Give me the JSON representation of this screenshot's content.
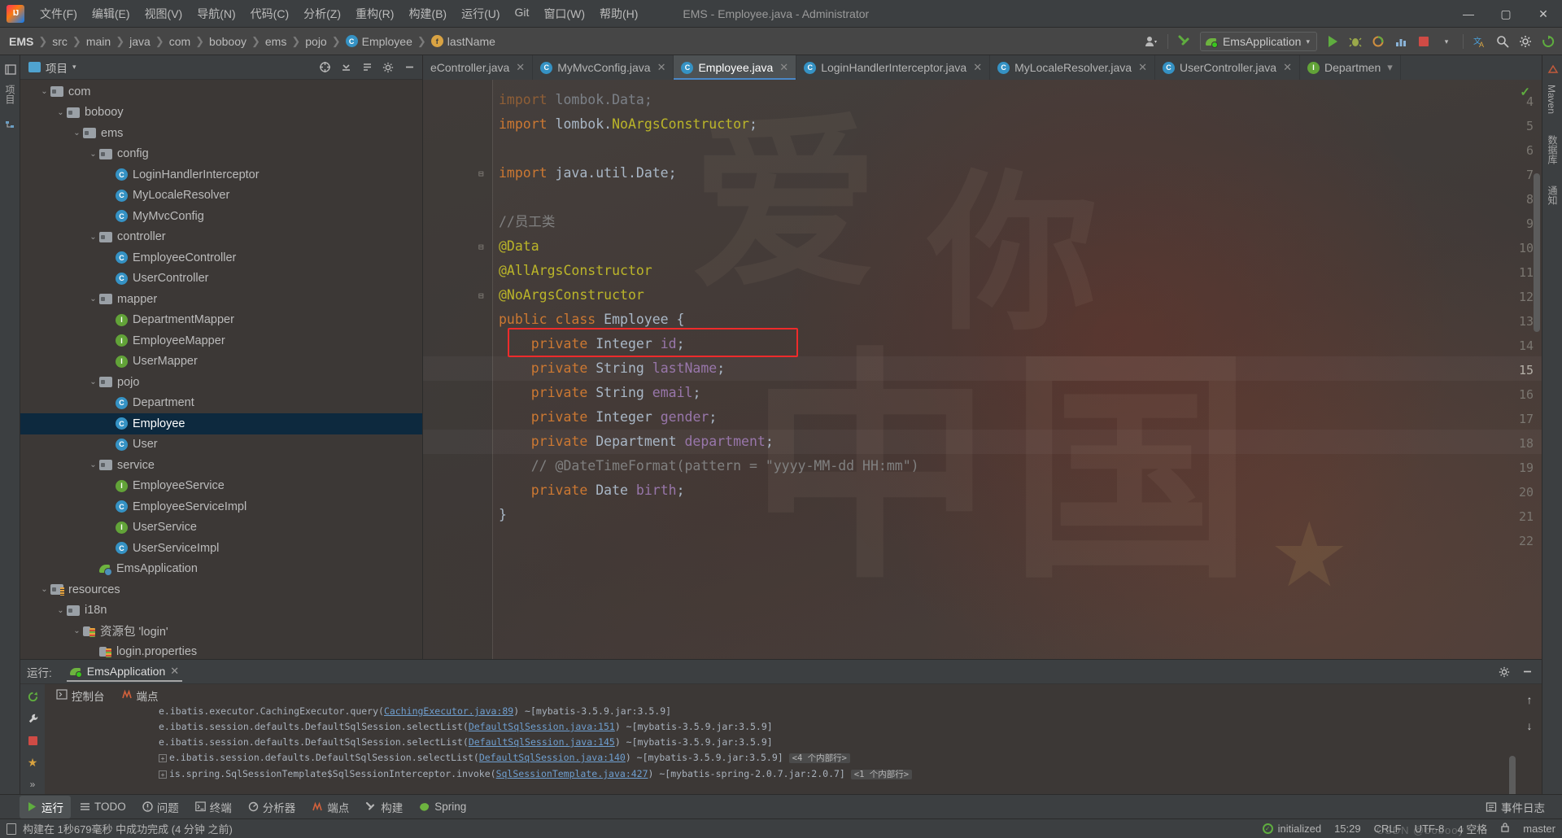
{
  "window": {
    "title": "EMS - Employee.java - Administrator",
    "minimize": "—",
    "maximize": "▢",
    "close": "✕"
  },
  "menu": {
    "items": [
      "文件(F)",
      "编辑(E)",
      "视图(V)",
      "导航(N)",
      "代码(C)",
      "分析(Z)",
      "重构(R)",
      "构建(B)",
      "运行(U)",
      "Git",
      "窗口(W)",
      "帮助(H)"
    ]
  },
  "navbar": {
    "breadcrumbs": [
      {
        "label": "EMS",
        "badge": ""
      },
      {
        "label": "src",
        "badge": ""
      },
      {
        "label": "main",
        "badge": ""
      },
      {
        "label": "java",
        "badge": ""
      },
      {
        "label": "com",
        "badge": ""
      },
      {
        "label": "bobooy",
        "badge": ""
      },
      {
        "label": "ems",
        "badge": ""
      },
      {
        "label": "pojo",
        "badge": ""
      },
      {
        "label": "Employee",
        "badge": "C"
      },
      {
        "label": "lastName",
        "badge": "f"
      }
    ],
    "separator": "❯",
    "run_config": "EmsApplication",
    "run_config_caret": "▾",
    "icons": {
      "user": "user-icon",
      "build": "build-hammer-icon",
      "run": "run-icon",
      "debug": "debug-icon",
      "coverage": "coverage-icon",
      "profile": "profile-icon",
      "stop": "stop-icon",
      "translate": "translate-icon",
      "search": "search-icon",
      "settings": "gear-icon",
      "updates": "updates-icon"
    }
  },
  "left_strip": {
    "project": "项目",
    "structure": "结构"
  },
  "right_strip": {
    "maven": "Maven",
    "database": "数据库",
    "notifications": "通知"
  },
  "project_panel": {
    "title": "项目",
    "caret": "▾",
    "header_icons": [
      "target-icon",
      "collapse-all-icon",
      "expand-icon",
      "gear-icon",
      "hide-icon"
    ],
    "tree": [
      {
        "depth": 2,
        "arrow": "⌄",
        "icon": "folder",
        "label": "com",
        "selected": false
      },
      {
        "depth": 3,
        "arrow": "⌄",
        "icon": "folder",
        "label": "bobooy",
        "selected": false
      },
      {
        "depth": 4,
        "arrow": "⌄",
        "icon": "folder",
        "label": "ems",
        "selected": false
      },
      {
        "depth": 5,
        "arrow": "⌄",
        "icon": "folder",
        "label": "config",
        "selected": false
      },
      {
        "depth": 6,
        "arrow": "",
        "icon": "class",
        "label": "LoginHandlerInterceptor",
        "selected": false
      },
      {
        "depth": 6,
        "arrow": "",
        "icon": "class",
        "label": "MyLocaleResolver",
        "selected": false
      },
      {
        "depth": 6,
        "arrow": "",
        "icon": "class",
        "label": "MyMvcConfig",
        "selected": false
      },
      {
        "depth": 5,
        "arrow": "⌄",
        "icon": "folder",
        "label": "controller",
        "selected": false
      },
      {
        "depth": 6,
        "arrow": "",
        "icon": "class",
        "label": "EmployeeController",
        "selected": false
      },
      {
        "depth": 6,
        "arrow": "",
        "icon": "class",
        "label": "UserController",
        "selected": false
      },
      {
        "depth": 5,
        "arrow": "⌄",
        "icon": "folder",
        "label": "mapper",
        "selected": false
      },
      {
        "depth": 6,
        "arrow": "",
        "icon": "interface",
        "label": "DepartmentMapper",
        "selected": false
      },
      {
        "depth": 6,
        "arrow": "",
        "icon": "interface",
        "label": "EmployeeMapper",
        "selected": false
      },
      {
        "depth": 6,
        "arrow": "",
        "icon": "interface",
        "label": "UserMapper",
        "selected": false
      },
      {
        "depth": 5,
        "arrow": "⌄",
        "icon": "folder",
        "label": "pojo",
        "selected": false
      },
      {
        "depth": 6,
        "arrow": "",
        "icon": "class",
        "label": "Department",
        "selected": false
      },
      {
        "depth": 6,
        "arrow": "",
        "icon": "class",
        "label": "Employee",
        "selected": true
      },
      {
        "depth": 6,
        "arrow": "",
        "icon": "class",
        "label": "User",
        "selected": false
      },
      {
        "depth": 5,
        "arrow": "⌄",
        "icon": "folder",
        "label": "service",
        "selected": false
      },
      {
        "depth": 6,
        "arrow": "",
        "icon": "interface",
        "label": "EmployeeService",
        "selected": false
      },
      {
        "depth": 6,
        "arrow": "",
        "icon": "class",
        "label": "EmployeeServiceImpl",
        "selected": false
      },
      {
        "depth": 6,
        "arrow": "",
        "icon": "interface",
        "label": "UserService",
        "selected": false
      },
      {
        "depth": 6,
        "arrow": "",
        "icon": "class",
        "label": "UserServiceImpl",
        "selected": false
      },
      {
        "depth": 5,
        "arrow": "",
        "icon": "spring",
        "label": "EmsApplication",
        "selected": false
      },
      {
        "depth": 2,
        "arrow": "⌄",
        "icon": "resfolder",
        "label": "resources",
        "selected": false
      },
      {
        "depth": 3,
        "arrow": "⌄",
        "icon": "folder",
        "label": "i18n",
        "selected": false
      },
      {
        "depth": 4,
        "arrow": "⌄",
        "icon": "bundle",
        "label": "资源包 'login'",
        "selected": false
      },
      {
        "depth": 5,
        "arrow": "",
        "icon": "properties",
        "label": "login.properties",
        "selected": false
      }
    ]
  },
  "editor": {
    "tabs": [
      {
        "label": "eController.java",
        "badge": "",
        "active": false
      },
      {
        "label": "MyMvcConfig.java",
        "badge": "C",
        "active": false
      },
      {
        "label": "Employee.java",
        "badge": "C",
        "active": true
      },
      {
        "label": "LoginHandlerInterceptor.java",
        "badge": "C",
        "active": false
      },
      {
        "label": "MyLocaleResolver.java",
        "badge": "C",
        "active": false
      },
      {
        "label": "UserController.java",
        "badge": "C",
        "active": false
      },
      {
        "label": "Departmen",
        "badge": "I",
        "active": false
      }
    ],
    "tab_close": "✕",
    "inspection_ok": "✓",
    "lines": [
      {
        "num": "4",
        "fold": "",
        "partial": true,
        "tokens": [
          {
            "t": "import ",
            "c": "k"
          },
          {
            "t": "lombok.Data;",
            "c": "ty"
          }
        ]
      },
      {
        "num": "5",
        "fold": "",
        "tokens": [
          {
            "t": "import ",
            "c": "k"
          },
          {
            "t": "lombok.",
            "c": "ty"
          },
          {
            "t": "NoArgsConstructor",
            "c": "an"
          },
          {
            "t": ";",
            "c": "ty"
          }
        ]
      },
      {
        "num": "6",
        "fold": "",
        "tokens": []
      },
      {
        "num": "7",
        "fold": "⊟",
        "tokens": [
          {
            "t": "import ",
            "c": "k"
          },
          {
            "t": "java.util.Date;",
            "c": "ty"
          }
        ]
      },
      {
        "num": "8",
        "fold": "",
        "tokens": []
      },
      {
        "num": "9",
        "fold": "",
        "tokens": [
          {
            "t": "//员工类",
            "c": "cm"
          }
        ]
      },
      {
        "num": "10",
        "fold": "⊟",
        "tokens": [
          {
            "t": "@Data",
            "c": "an"
          }
        ]
      },
      {
        "num": "11",
        "fold": "",
        "tokens": [
          {
            "t": "@AllArgsConstructor",
            "c": "an"
          }
        ]
      },
      {
        "num": "12",
        "fold": "⊟",
        "tokens": [
          {
            "t": "@NoArgsConstructor",
            "c": "an"
          }
        ]
      },
      {
        "num": "13",
        "fold": "",
        "tokens": [
          {
            "t": "public class ",
            "c": "k"
          },
          {
            "t": "Employee ",
            "c": "ty"
          },
          {
            "t": "{",
            "c": "ty"
          }
        ]
      },
      {
        "num": "14",
        "fold": "",
        "tokens": [
          {
            "t": "    private ",
            "c": "k"
          },
          {
            "t": "Integer ",
            "c": "ty"
          },
          {
            "t": "id",
            "c": "fl"
          },
          {
            "t": ";",
            "c": "ty"
          }
        ]
      },
      {
        "num": "15",
        "fold": "",
        "current": true,
        "tokens": [
          {
            "t": "    private ",
            "c": "k"
          },
          {
            "t": "String ",
            "c": "ty"
          },
          {
            "t": "lastName",
            "c": "fl"
          },
          {
            "t": ";",
            "c": "ty"
          }
        ]
      },
      {
        "num": "16",
        "fold": "",
        "tokens": [
          {
            "t": "    private ",
            "c": "k"
          },
          {
            "t": "String ",
            "c": "ty"
          },
          {
            "t": "email",
            "c": "fl"
          },
          {
            "t": ";",
            "c": "ty"
          }
        ]
      },
      {
        "num": "17",
        "fold": "",
        "tokens": [
          {
            "t": "    private ",
            "c": "k"
          },
          {
            "t": "Integer ",
            "c": "ty"
          },
          {
            "t": "gender",
            "c": "fl"
          },
          {
            "t": ";",
            "c": "ty"
          }
        ]
      },
      {
        "num": "18",
        "fold": "",
        "highlighted": true,
        "tokens": [
          {
            "t": "    private ",
            "c": "k"
          },
          {
            "t": "Department ",
            "c": "ty"
          },
          {
            "t": "department",
            "c": "fl"
          },
          {
            "t": ";",
            "c": "ty"
          }
        ]
      },
      {
        "num": "19",
        "fold": "",
        "tokens": [
          {
            "t": "    // @DateTimeFormat(pattern = \"yyyy-MM-dd HH:mm\")",
            "c": "cm"
          }
        ]
      },
      {
        "num": "20",
        "fold": "",
        "tokens": [
          {
            "t": "    private ",
            "c": "k"
          },
          {
            "t": "Date ",
            "c": "ty"
          },
          {
            "t": "birth",
            "c": "fl"
          },
          {
            "t": ";",
            "c": "ty"
          }
        ]
      },
      {
        "num": "21",
        "fold": "",
        "tokens": [
          {
            "t": "}",
            "c": "ty"
          }
        ]
      },
      {
        "num": "22",
        "fold": "",
        "tokens": []
      }
    ]
  },
  "run_panel": {
    "label": "运行:",
    "tab": "EmsApplication",
    "tab_close": "✕",
    "console_tabs": [
      {
        "label": "控制台",
        "icon": "console-icon",
        "active": true
      },
      {
        "label": "端点",
        "icon": "endpoints-icon",
        "active": false
      }
    ],
    "gear_icon": "gear-icon",
    "minimize_icon": "minimize-icon",
    "left_tools": [
      "rerun-icon",
      "wrench-icon",
      "stop-icon",
      "star-icon"
    ],
    "arrows": [
      "up-arrow-icon",
      "down-arrow-icon",
      "chevrons-icon",
      "chevrons2-icon"
    ],
    "output": [
      {
        "pre": "",
        "text": "e.ibatis.executor.CachingExecutor.query(",
        "link": "CachingExecutor.java:89",
        "post": ") ~[mybatis-3.5.9.jar:3.5.9]",
        "fold": ""
      },
      {
        "pre": "",
        "text": "e.ibatis.session.defaults.DefaultSqlSession.selectList(",
        "link": "DefaultSqlSession.java:151",
        "post": ") ~[mybatis-3.5.9.jar:3.5.9]",
        "fold": ""
      },
      {
        "pre": "",
        "text": "e.ibatis.session.defaults.DefaultSqlSession.selectList(",
        "link": "DefaultSqlSession.java:145",
        "post": ") ~[mybatis-3.5.9.jar:3.5.9]",
        "fold": ""
      },
      {
        "pre": "⊞",
        "text": "e.ibatis.session.defaults.DefaultSqlSession.selectList(",
        "link": "DefaultSqlSession.java:140",
        "post": ") ~[mybatis-3.5.9.jar:3.5.9]",
        "fold": "<4 个内部行>"
      },
      {
        "pre": "⊞",
        "text": "is.spring.SqlSessionTemplate$SqlSessionInterceptor.invoke(",
        "link": "SqlSessionTemplate.java:427",
        "post": ") ~[mybatis-spring-2.0.7.jar:2.0.7]",
        "fold": "<1 个内部行>"
      }
    ]
  },
  "bottom_bar": {
    "items": [
      {
        "label": "运行",
        "icon": "run-icon",
        "active": true
      },
      {
        "label": "TODO",
        "icon": "todo-icon",
        "active": false
      },
      {
        "label": "问题",
        "icon": "problems-icon",
        "active": false
      },
      {
        "label": "终端",
        "icon": "terminal-icon",
        "active": false
      },
      {
        "label": "分析器",
        "icon": "profiler-icon",
        "active": false
      },
      {
        "label": "端点",
        "icon": "endpoints-icon",
        "active": false
      },
      {
        "label": "构建",
        "icon": "build-icon",
        "active": false
      },
      {
        "label": "Spring",
        "icon": "spring-icon",
        "active": false
      }
    ],
    "event_log": "事件日志",
    "event_log_icon": "event-log-icon"
  },
  "status_bar": {
    "message": "构建在 1秒679毫秒 中成功完成 (4 分钟 之前)",
    "doc_icon": "document-icon",
    "right": {
      "initialized": "initialized",
      "time": "15:29",
      "line_ending": "CRLF",
      "encoding": "UTF-8",
      "indent": "4 空格",
      "branch": "master",
      "lock_icon": "lock-icon"
    },
    "watermark": "CSDN @bobooy"
  },
  "colors": {
    "accent": "#4a88c7",
    "selection": "#0d293e",
    "keyword": "#cc7832",
    "annotation": "#bbb529",
    "field": "#9876aa",
    "comment": "#808080",
    "error_box": "#ee2b2b",
    "success": "#5fad3f",
    "panel_bg": "#3c3f41",
    "editor_bg": "#3f3b39"
  }
}
